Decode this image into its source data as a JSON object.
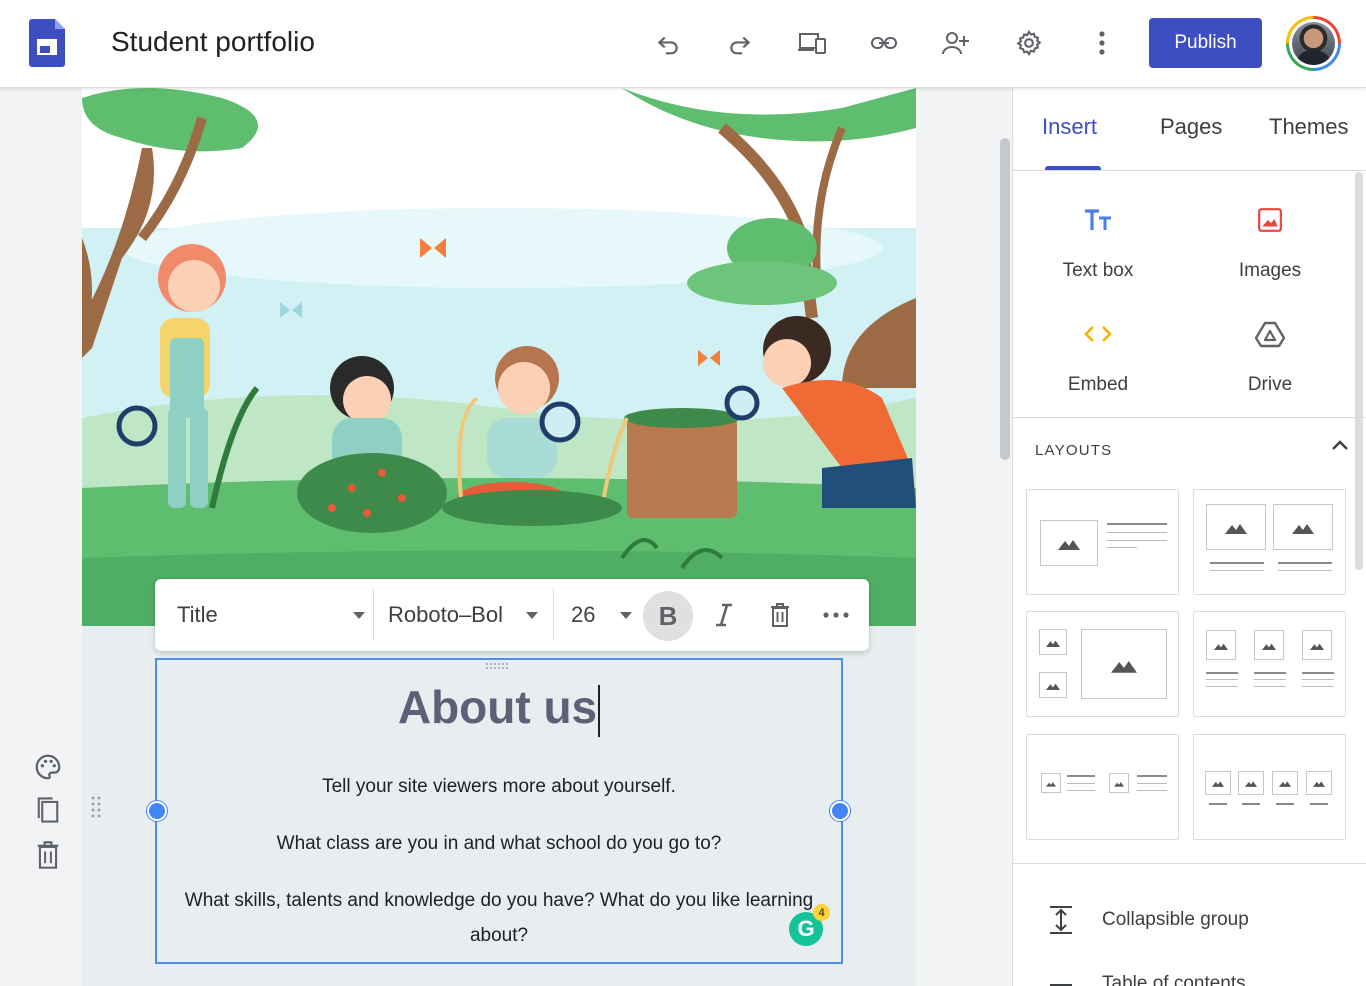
{
  "app": {
    "doc_title": "Student portfolio",
    "publish_label": "Publish"
  },
  "toolbar_icons": [
    "undo-icon",
    "redo-icon",
    "preview-icon",
    "link-icon",
    "share-icon",
    "settings-icon",
    "more-icon"
  ],
  "format_bar": {
    "style_value": "Title",
    "font_value": "Roboto-Bold",
    "font_value_visible": "Roboto–Bol",
    "size_value": "26",
    "bold_label": "B"
  },
  "text_box": {
    "heading": "About us",
    "lines": [
      "Tell your site viewers more about yourself.",
      "What class are you in and what school do you go to?",
      "What skills, talents and knowledge do you have? What do you like learning",
      "about?"
    ]
  },
  "grammarly": {
    "letter": "G",
    "count": "4"
  },
  "panel": {
    "tabs": [
      "Insert",
      "Pages",
      "Themes"
    ],
    "active_tab": "Insert",
    "insert_items": [
      {
        "label": "Text box",
        "icon": "text-box-icon"
      },
      {
        "label": "Images",
        "icon": "image-icon"
      },
      {
        "label": "Embed",
        "icon": "embed-icon"
      },
      {
        "label": "Drive",
        "icon": "drive-icon"
      }
    ],
    "layouts_title": "LAYOUTS",
    "bottom_items": [
      {
        "label": "Collapsible group",
        "icon": "collapsible-icon"
      },
      {
        "label": "Table of contents",
        "icon": "toc-icon"
      }
    ]
  },
  "colors": {
    "accent": "#3c4ec2",
    "selection": "#4c8ee8",
    "heading": "#5c6178",
    "grass": "#5ebd6f"
  }
}
